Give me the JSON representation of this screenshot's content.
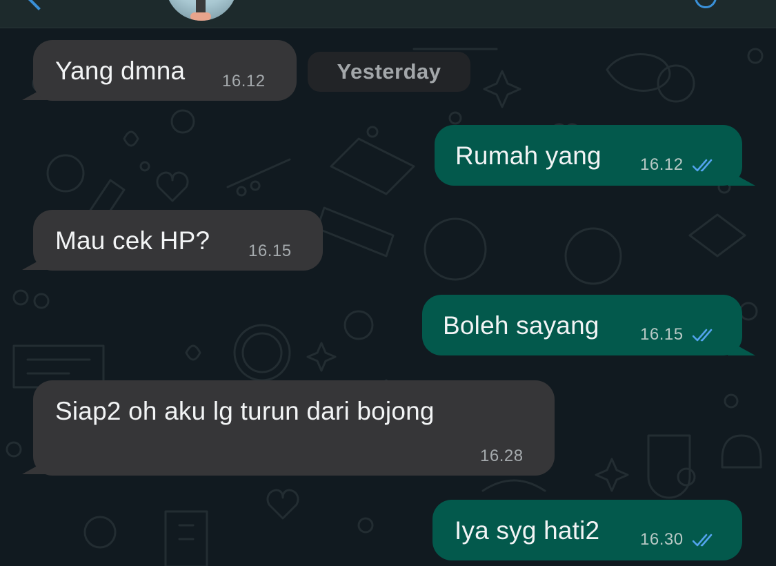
{
  "header": {
    "avatar_icon": "contact-avatar",
    "back_icon": "chevron-left-icon",
    "call_icon": "phone-icon"
  },
  "date_separator": "Yesterday",
  "colors": {
    "incoming_bubble": "#363638",
    "outgoing_bubble": "#03594c",
    "read_ticks": "#53a3ee",
    "background": "#111a20"
  },
  "messages": [
    {
      "direction": "in",
      "text": "Yang dmna",
      "time": "16.12"
    },
    {
      "direction": "out",
      "text": "Rumah yang",
      "time": "16.12",
      "status": "read"
    },
    {
      "direction": "in",
      "text": "Mau cek HP?",
      "time": "16.15"
    },
    {
      "direction": "out",
      "text": "Boleh sayang",
      "time": "16.15",
      "status": "read"
    },
    {
      "direction": "in",
      "text": "Siap2 oh aku lg turun dari bojong",
      "time": "16.28"
    },
    {
      "direction": "out",
      "text": "Iya syg hati2",
      "time": "16.30",
      "status": "read"
    }
  ]
}
